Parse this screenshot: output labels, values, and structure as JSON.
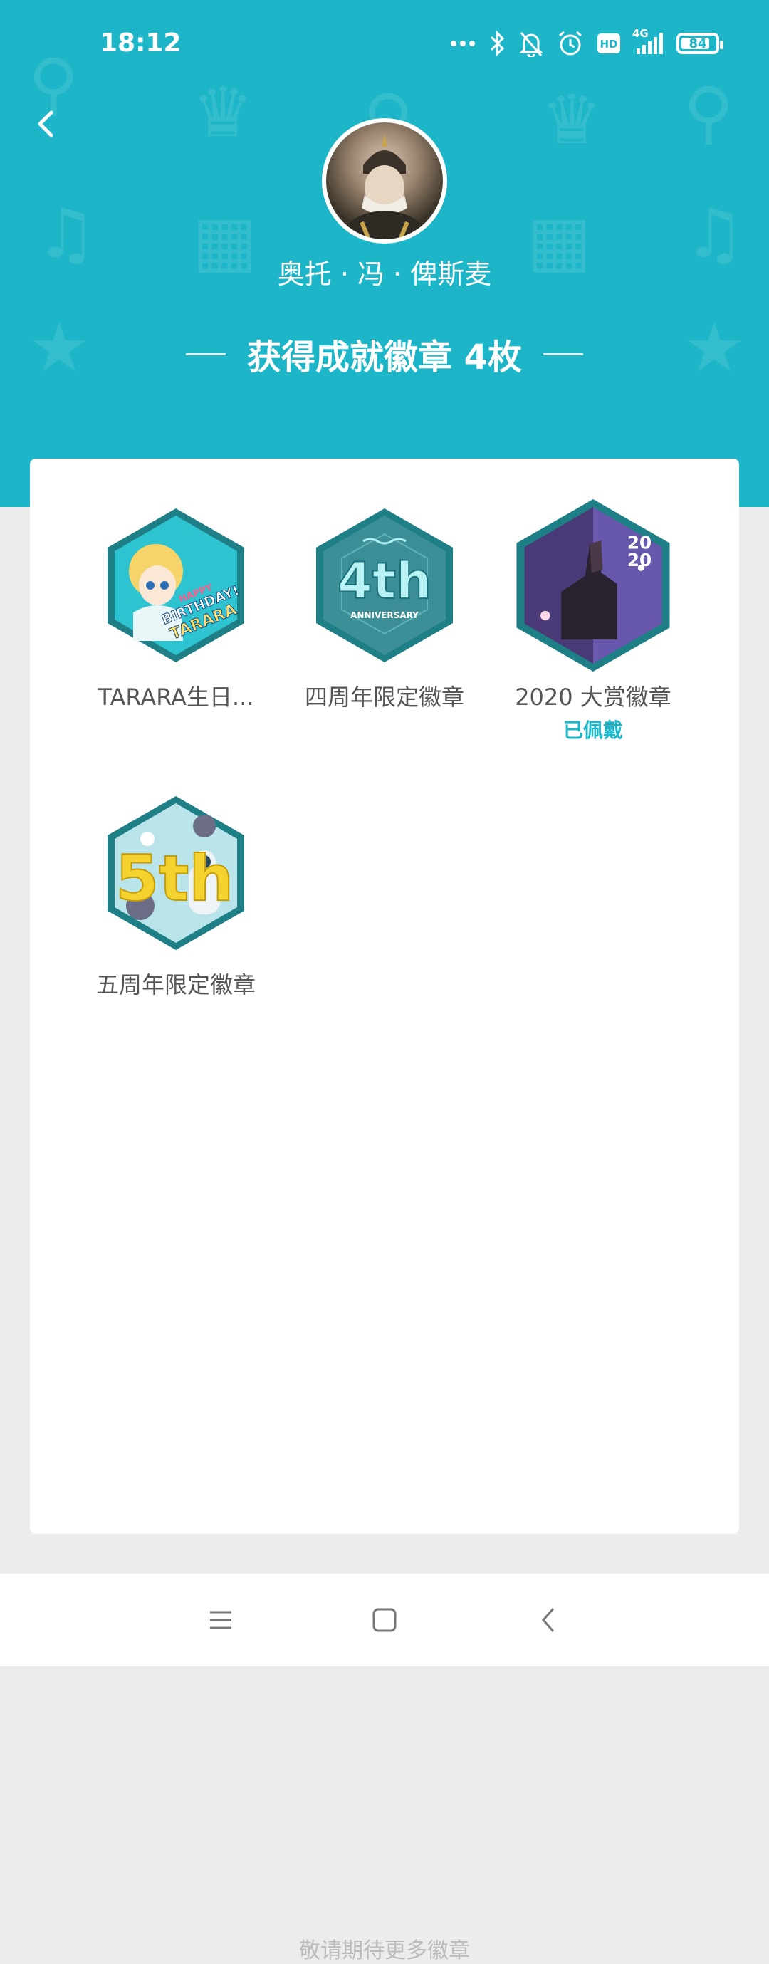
{
  "status_bar": {
    "time": "18:12",
    "network": "4G",
    "hd_label": "HD",
    "battery_level": "84",
    "icons": [
      "more-dots-icon",
      "bluetooth-icon",
      "mute-bell-icon",
      "alarm-icon",
      "hd-icon",
      "signal-icon",
      "battery-icon"
    ]
  },
  "profile": {
    "username": "奥托 · 冯 · 俾斯麦"
  },
  "achievements": {
    "title": "获得成就徽章 4枚",
    "badges": [
      {
        "name": "TARARA生日...",
        "status": "",
        "art_text": [
          "HAPPY",
          "BIRTHDAY!",
          "TARARA"
        ]
      },
      {
        "name": "四周年限定徽章",
        "status": "",
        "art_text": [
          "4th",
          "ANNIVERSARY"
        ]
      },
      {
        "name": "2020 大赏徽章",
        "status": "已佩戴",
        "art_text": [
          "20",
          "20"
        ]
      },
      {
        "name": "五周年限定徽章",
        "status": "",
        "art_text": [
          "5th"
        ]
      }
    ],
    "footer": "敬请期待更多徽章"
  },
  "colors": {
    "accent": "#1cb6c8",
    "badge_rim": "#1f7f86",
    "page_bg": "#ececec"
  }
}
